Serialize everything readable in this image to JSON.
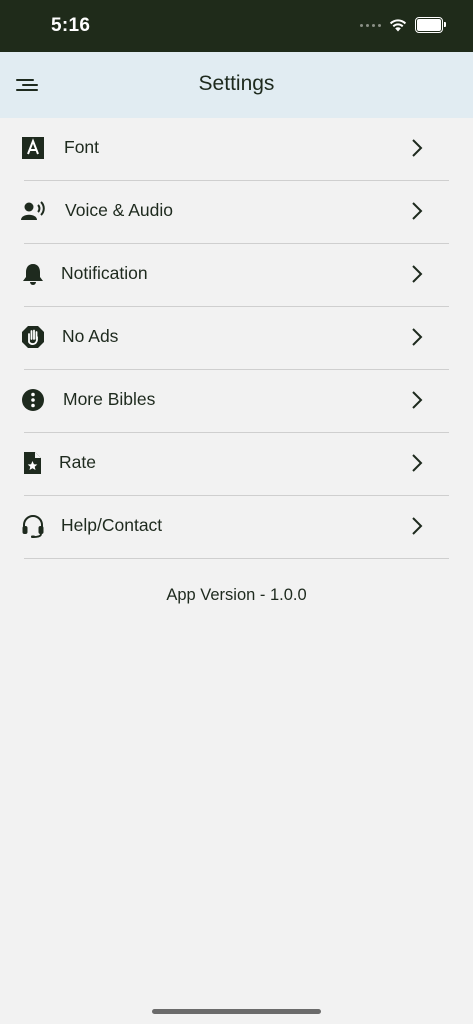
{
  "status_bar": {
    "time": "5:16"
  },
  "header": {
    "title": "Settings",
    "menu_icon": "menu-icon"
  },
  "settings": [
    {
      "label": "Font",
      "icon": "font-icon"
    },
    {
      "label": "Voice & Audio",
      "icon": "voice-audio-icon"
    },
    {
      "label": "Notification",
      "icon": "bell-icon"
    },
    {
      "label": "No Ads",
      "icon": "hand-stop-icon"
    },
    {
      "label": "More Bibles",
      "icon": "info-dots-icon"
    },
    {
      "label": "Rate",
      "icon": "star-file-icon"
    },
    {
      "label": "Help/Contact",
      "icon": "headset-icon"
    }
  ],
  "footer": {
    "app_version": "App Version - 1.0.0"
  },
  "colors": {
    "status_bar_bg": "#1f2b1a",
    "header_bg": "#e1ecf2",
    "page_bg": "#f2f2f2",
    "text": "#1e2a1e"
  }
}
